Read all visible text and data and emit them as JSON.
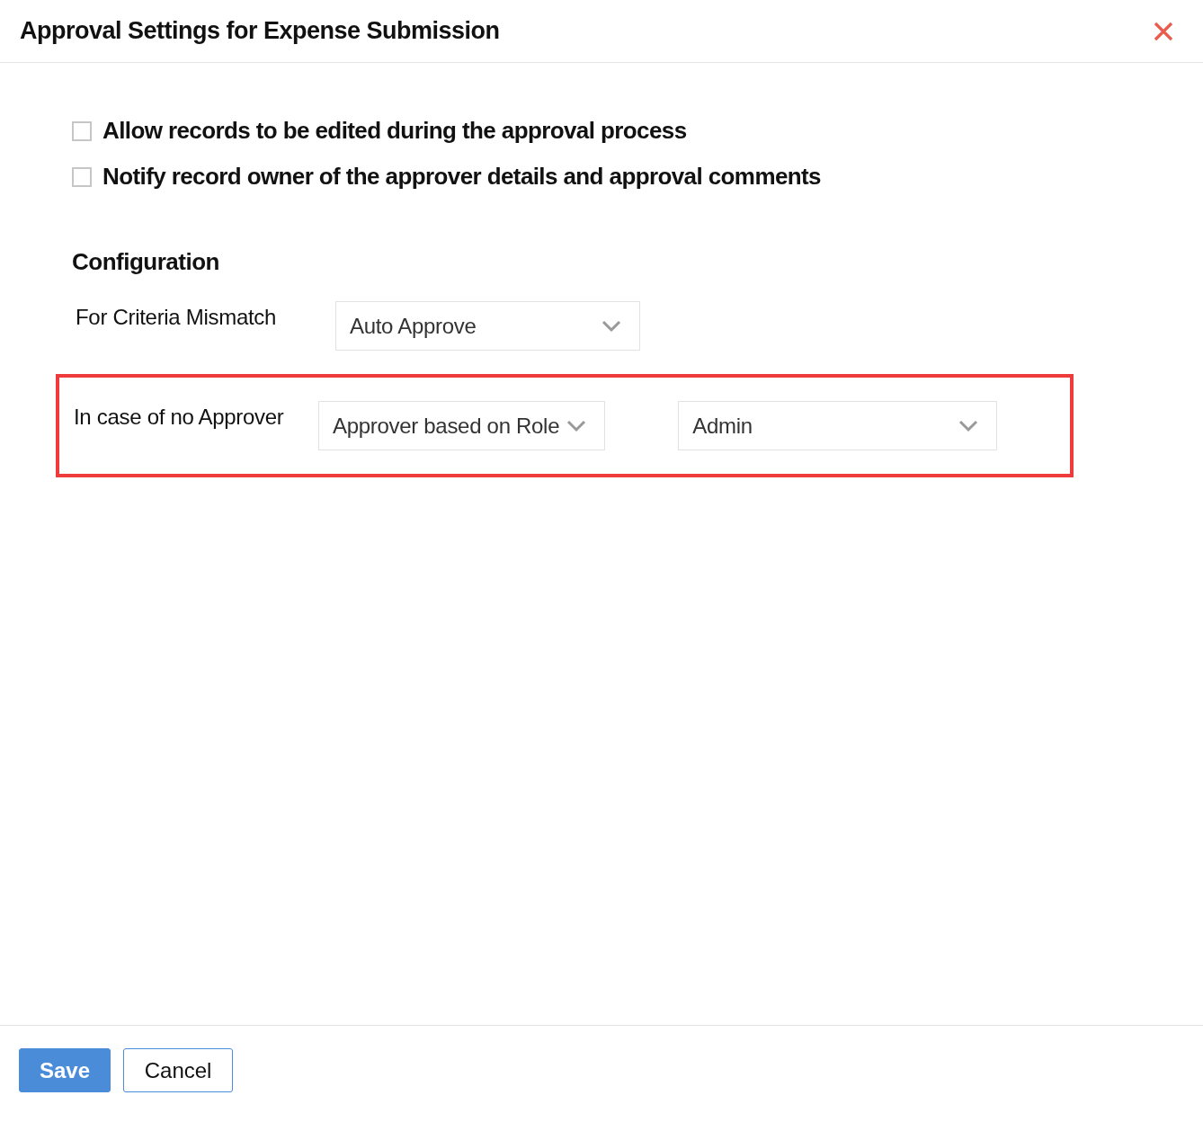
{
  "dialog": {
    "title": "Approval Settings for Expense Submission"
  },
  "options": [
    {
      "label": "Allow records to be edited during the approval process",
      "checked": false
    },
    {
      "label": "Notify record owner of the approver details and approval comments",
      "checked": false
    }
  ],
  "configuration": {
    "heading": "Configuration",
    "rows": [
      {
        "label": "For Criteria Mismatch",
        "highlighted": false,
        "selects": [
          "Auto Approve"
        ]
      },
      {
        "label": "In case of no Approver",
        "highlighted": true,
        "selects": [
          "Approver based on Role",
          "Admin"
        ]
      }
    ]
  },
  "buttons": [
    {
      "label": "Save",
      "kind": "primary"
    },
    {
      "label": "Cancel",
      "kind": "secondary"
    }
  ]
}
